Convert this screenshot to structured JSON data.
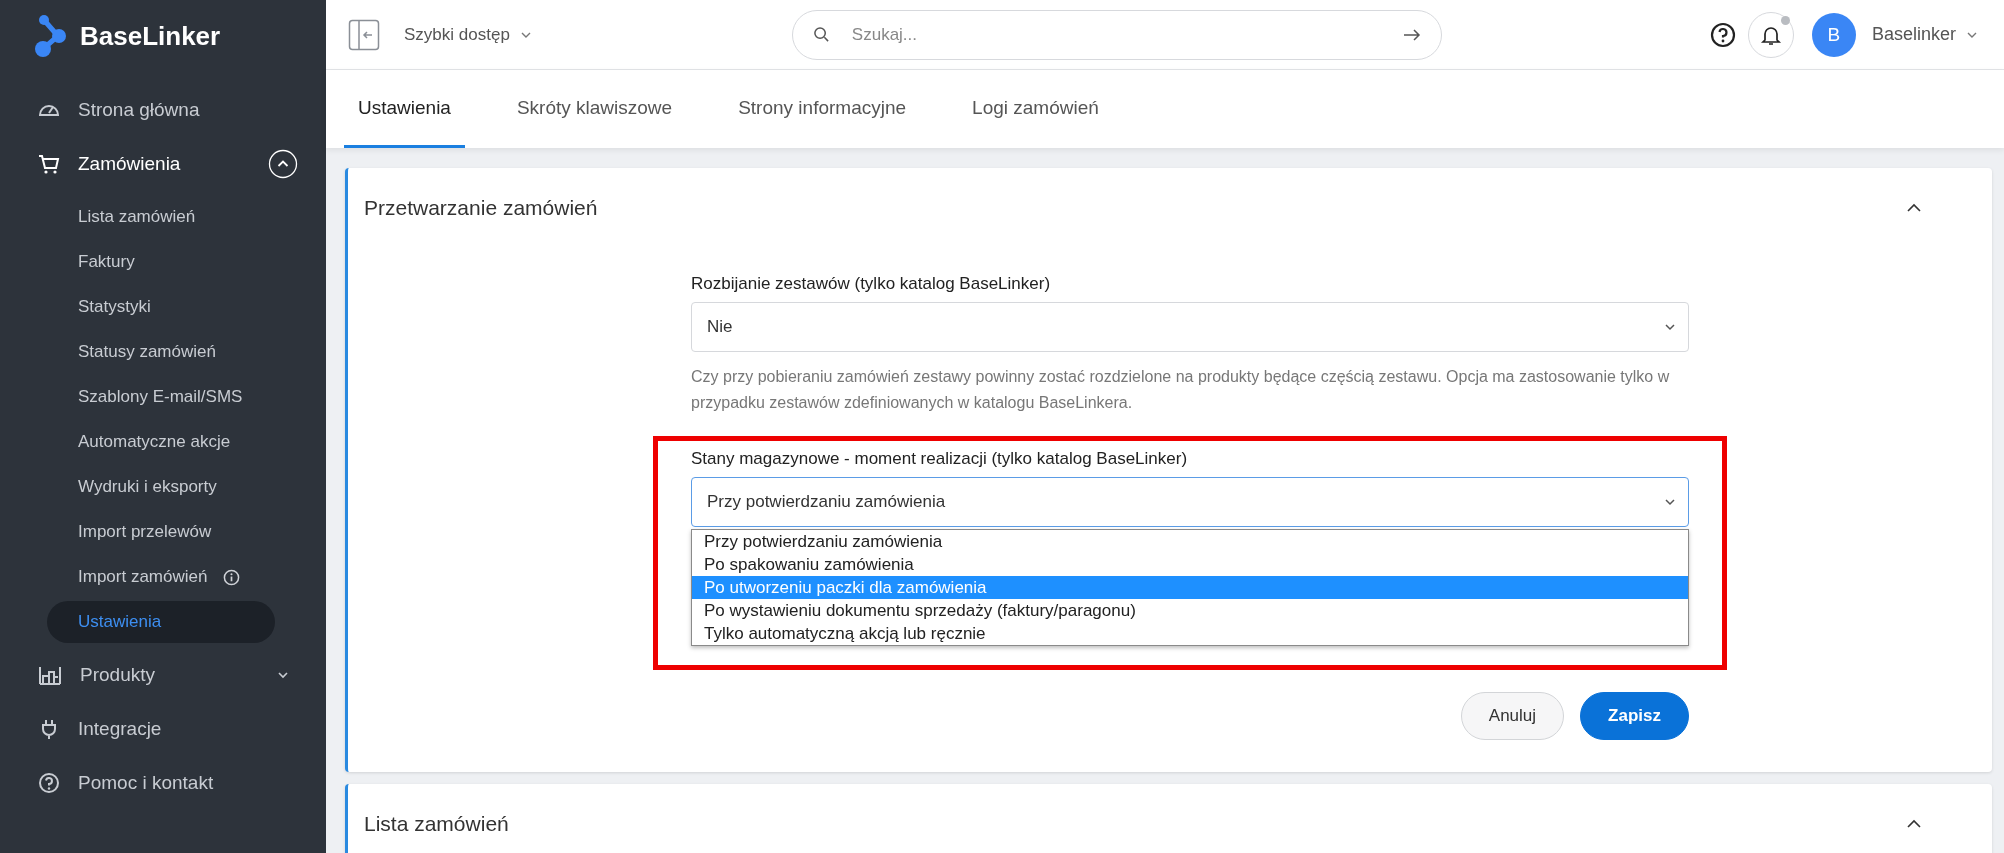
{
  "sidebar": {
    "logo": "BaseLinker",
    "items": [
      {
        "label": "Strona główna"
      },
      {
        "label": "Zamówienia",
        "expanded": true,
        "children": [
          {
            "label": "Lista zamówień",
            "selected": false,
            "info": false
          },
          {
            "label": "Faktury",
            "selected": false,
            "info": false
          },
          {
            "label": "Statystyki",
            "selected": false,
            "info": false
          },
          {
            "label": "Statusy zamówień",
            "selected": false,
            "info": false
          },
          {
            "label": "Szablony E-mail/SMS",
            "selected": false,
            "info": false
          },
          {
            "label": "Automatyczne akcje",
            "selected": false,
            "info": false
          },
          {
            "label": "Wydruki i eksporty",
            "selected": false,
            "info": false
          },
          {
            "label": "Import przelewów",
            "selected": false,
            "info": false
          },
          {
            "label": "Import zamówień",
            "selected": false,
            "info": true
          },
          {
            "label": "Ustawienia",
            "selected": true,
            "info": false
          }
        ]
      },
      {
        "label": "Produkty",
        "expanded": false
      },
      {
        "label": "Integracje"
      },
      {
        "label": "Pomoc i kontakt"
      }
    ]
  },
  "topbar": {
    "quick_access": "Szybki dostęp",
    "search": {
      "placeholder": "Szukaj..."
    },
    "avatar": "B",
    "user": "Baselinker"
  },
  "tabs": [
    {
      "label": "Ustawienia",
      "selected": true
    },
    {
      "label": "Skróty klawiszowe",
      "selected": false
    },
    {
      "label": "Strony informacyjne",
      "selected": false
    },
    {
      "label": "Logi zamówień",
      "selected": false
    }
  ],
  "cards": [
    {
      "title": "Przetwarzanie zamówień",
      "expanded": true,
      "fields": [
        {
          "label": "Rozbijanie zestawów (tylko katalog BaseLinker)",
          "value": "Nie",
          "help": "Czy przy pobieraniu zamówień zestawy powinny zostać rozdzielone na produkty będące częścią zestawu. Opcja ma zastosowanie tylko w przypadku zestawów zdefiniowanych w katalogu BaseLinkera."
        },
        {
          "label": "Stany magazynowe - moment realizacji (tylko katalog BaseLinker)",
          "value": "Przy potwierdzaniu zamówienia",
          "highlighted": true,
          "options": [
            {
              "label": "Przy potwierdzaniu zamówienia",
              "highlighted": false
            },
            {
              "label": "Po spakowaniu zamówienia",
              "highlighted": false
            },
            {
              "label": "Po utworzeniu paczki dla zamówienia",
              "highlighted": true
            },
            {
              "label": "Po wystawieniu dokumentu sprzedaży (faktury/paragonu)",
              "highlighted": false
            },
            {
              "label": "Tylko automatyczną akcją lub ręcznie",
              "highlighted": false
            }
          ]
        }
      ],
      "buttons": [
        {
          "label": "Anuluj",
          "kind": "secondary"
        },
        {
          "label": "Zapisz",
          "kind": "primary"
        }
      ]
    },
    {
      "title": "Lista zamówień",
      "expanded": true
    }
  ]
}
